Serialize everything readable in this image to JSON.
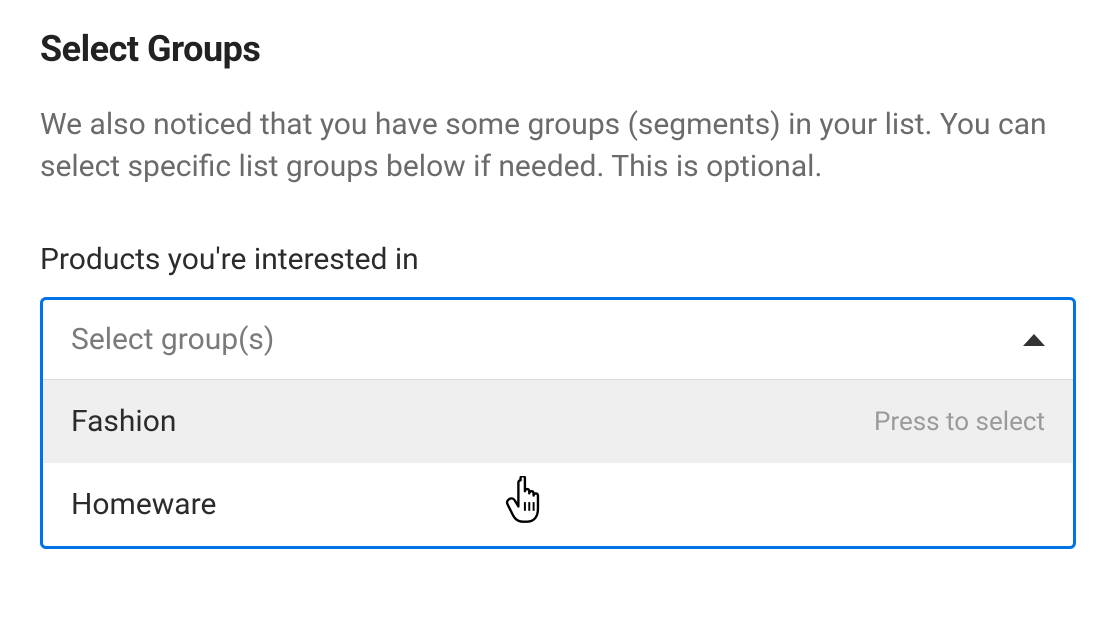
{
  "heading": "Select Groups",
  "description": "We also noticed that you have some groups (segments) in your list. You can select specific list groups below if needed. This is optional.",
  "field_label": "Products you're interested in",
  "dropdown": {
    "placeholder": "Select group(s)",
    "options": [
      {
        "label": "Fashion",
        "hint": "Press to select",
        "hovered": true
      },
      {
        "label": "Homeware",
        "hint": "",
        "hovered": false
      }
    ]
  }
}
